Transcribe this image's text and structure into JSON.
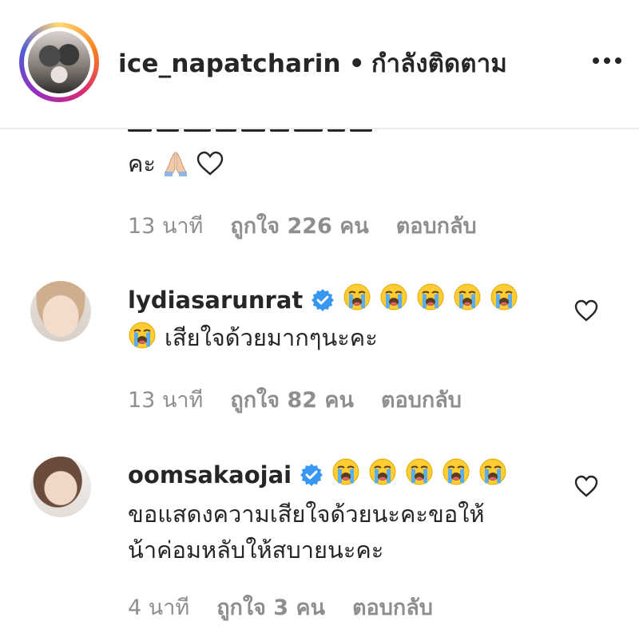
{
  "header": {
    "username": "ice_napatcharin",
    "separator": "•",
    "follow_status": "กำลังติดตาม"
  },
  "previous_comment": {
    "text_tail": "คะ",
    "emojis": [
      "folded-hands",
      "white-heart"
    ],
    "time": "13 นาที",
    "likes": "ถูกใจ 226 คน",
    "reply": "ตอบกลับ"
  },
  "comments": [
    {
      "username": "lydiasarunrat",
      "verified": true,
      "emoji_count_line1": 5,
      "line2_emoji_count": 1,
      "text": "เสียใจด้วยมากๆนะคะ",
      "time": "13 นาที",
      "likes": "ถูกใจ 82 คน",
      "reply": "ตอบกลับ"
    },
    {
      "username": "oomsakaojai",
      "verified": true,
      "emoji_count_line1": 5,
      "text_line1": "ขอแสดงความเสียใจด้วยนะคะขอให้",
      "text_line2": "น้าค่อมหลับให้สบายนะคะ",
      "time": "4 นาที",
      "likes": "ถูกใจ 3 คน",
      "reply": "ตอบกลับ"
    }
  ],
  "colors": {
    "text": "#262626",
    "meta": "#8e8e8e",
    "verified": "#3897f0",
    "emoji_face": "#ffcc33",
    "tears": "#5dadec"
  }
}
